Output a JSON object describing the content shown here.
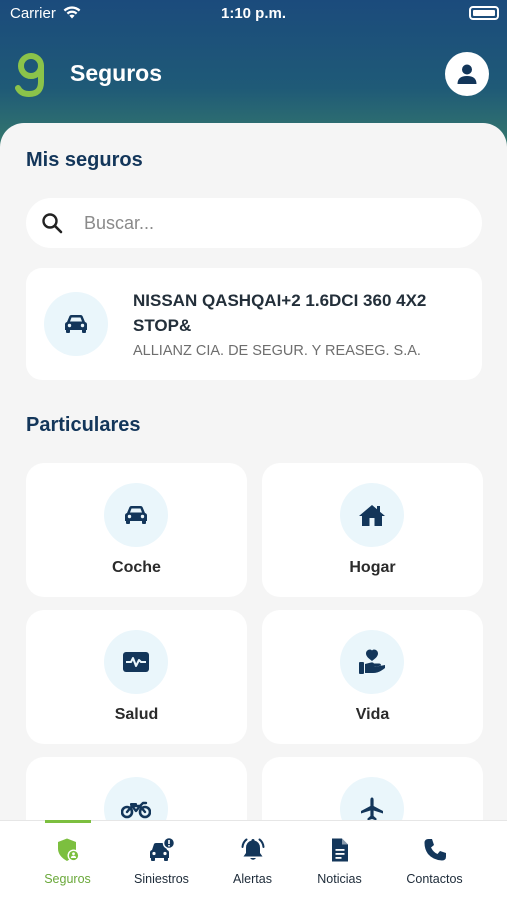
{
  "status_bar": {
    "carrier": "Carrier",
    "time": "1:10 p.m."
  },
  "header": {
    "title": "Seguros",
    "logo_icon": "g-logo",
    "profile_icon": "user-icon"
  },
  "my_policies": {
    "title": "Mis seguros",
    "search_placeholder": "Buscar...",
    "search_value": "",
    "policies": [
      {
        "icon": "car-icon",
        "name": "NISSAN QASHQAI+2 1.6DCI 360 4X2 STOP&",
        "insurer": "ALLIANZ CIA. DE SEGUR. Y REASEG. S.A."
      }
    ]
  },
  "particulares": {
    "title": "Particulares",
    "items": [
      {
        "label": "Coche",
        "icon": "car-icon"
      },
      {
        "label": "Hogar",
        "icon": "home-icon"
      },
      {
        "label": "Salud",
        "icon": "health-monitor-icon"
      },
      {
        "label": "Vida",
        "icon": "hand-heart-icon"
      },
      {
        "label": "",
        "icon": "motorcycle-icon"
      },
      {
        "label": "",
        "icon": "airplane-icon"
      }
    ]
  },
  "tabbar": {
    "active": "Seguros",
    "tabs": [
      {
        "label": "Seguros",
        "icon": "shield-user-icon"
      },
      {
        "label": "Siniestros",
        "icon": "car-crash-icon"
      },
      {
        "label": "Alertas",
        "icon": "bell-icon"
      },
      {
        "label": "Noticias",
        "icon": "document-icon"
      },
      {
        "label": "Contactos",
        "icon": "phone-icon"
      }
    ]
  },
  "colors": {
    "primary_dark": "#13365a",
    "accent_green": "#7cbf3f",
    "icon_bg": "#eaf6fb",
    "icon_fg": "#13365a",
    "header_top": "#1b4b7c",
    "header_bottom": "#3a7f6a"
  }
}
